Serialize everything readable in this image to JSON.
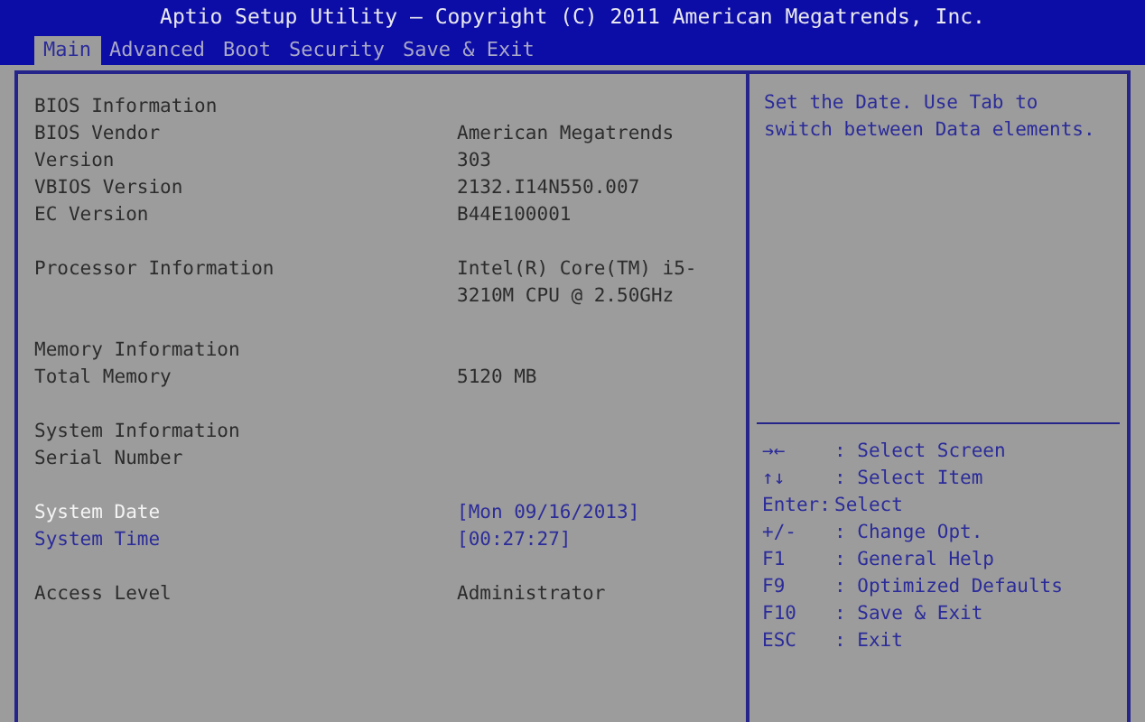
{
  "window": {
    "title": "Aptio Setup Utility – Copyright (C) 2011 American Megatrends, Inc."
  },
  "tabs": [
    {
      "label": "Main",
      "selected": true
    },
    {
      "label": "Advanced",
      "selected": false
    },
    {
      "label": "Boot",
      "selected": false
    },
    {
      "label": "Security",
      "selected": false
    },
    {
      "label": "Save & Exit",
      "selected": false
    }
  ],
  "groups": [
    {
      "rows": [
        {
          "kind": "heading",
          "label": "BIOS Information"
        },
        {
          "kind": "info",
          "label": "BIOS Vendor",
          "value_lines": [
            "American Megatrends"
          ]
        },
        {
          "kind": "info",
          "label": "Version",
          "value_lines": [
            "303"
          ]
        },
        {
          "kind": "info",
          "label": "VBIOS Version",
          "value_lines": [
            "2132.I14N550.007"
          ]
        },
        {
          "kind": "info",
          "label": "EC Version",
          "value_lines": [
            "B44E100001"
          ]
        }
      ]
    },
    {
      "rows": [
        {
          "kind": "info",
          "label": "Processor Information",
          "value_lines": [
            "Intel(R) Core(TM) i5-",
            "3210M CPU @ 2.50GHz"
          ]
        }
      ]
    },
    {
      "rows": [
        {
          "kind": "heading",
          "label": "Memory Information"
        },
        {
          "kind": "info",
          "label": "Total Memory",
          "value_lines": [
            "5120 MB"
          ]
        }
      ]
    },
    {
      "rows": [
        {
          "kind": "heading",
          "label": "System Information"
        },
        {
          "kind": "heading",
          "label": "Serial Number"
        }
      ]
    },
    {
      "rows": [
        {
          "kind": "field",
          "label": "System Date",
          "value_lines": [
            "[Mon 09/16/2013]"
          ],
          "selected": true
        },
        {
          "kind": "field",
          "label": "System Time",
          "value_lines": [
            "[00:27:27]"
          ],
          "selected": false
        }
      ]
    },
    {
      "rows": [
        {
          "kind": "info",
          "label": "Access Level",
          "value_lines": [
            "Administrator"
          ]
        }
      ]
    }
  ],
  "help": {
    "lines": [
      "Set the Date. Use Tab to",
      "switch between Data elements."
    ]
  },
  "keys": [
    {
      "key": "→←",
      "action": ": Select Screen"
    },
    {
      "key": "↑↓",
      "action": ": Select Item"
    },
    {
      "key": "Enter:",
      "action": "Select"
    },
    {
      "key": "+/-",
      "action": ": Change Opt."
    },
    {
      "key": "F1",
      "action": ": General Help"
    },
    {
      "key": "F9",
      "action": ": Optimized Defaults"
    },
    {
      "key": "F10",
      "action": ": Save & Exit"
    },
    {
      "key": "ESC",
      "action": ": Exit"
    }
  ]
}
